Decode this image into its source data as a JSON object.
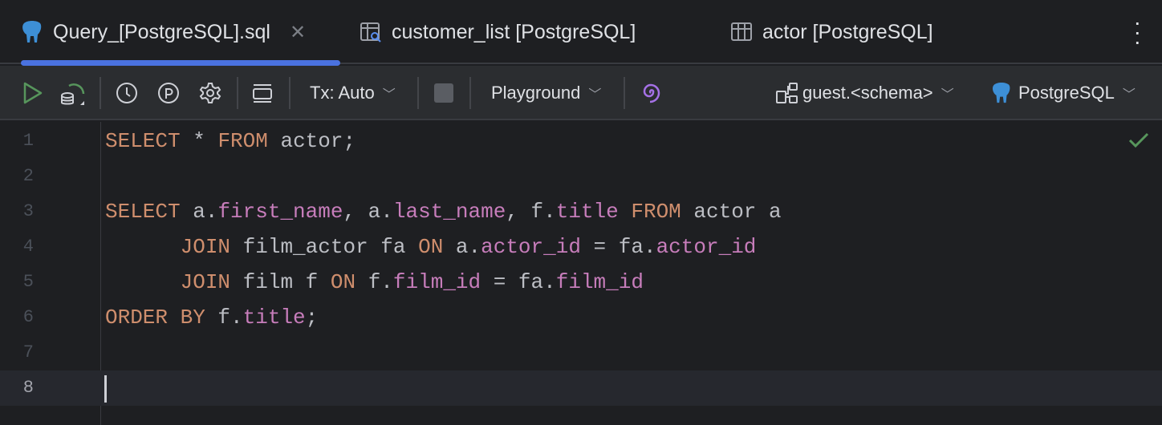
{
  "tabs": [
    {
      "label": "Query_[PostgreSQL].sql",
      "icon": "postgresql-icon",
      "active": true
    },
    {
      "label": "customer_list [PostgreSQL]",
      "icon": "table-view-icon"
    },
    {
      "label": "actor [PostgreSQL]",
      "icon": "table-icon"
    }
  ],
  "toolbar": {
    "tx": "Tx: Auto",
    "mode": "Playground",
    "schema": "guest.<schema>",
    "datasource": "PostgreSQL"
  },
  "editor": {
    "lines": [
      [
        [
          "kw",
          "SELECT"
        ],
        [
          "t",
          " * "
        ],
        [
          "kw",
          "FROM"
        ],
        [
          "t",
          " actor;"
        ]
      ],
      [],
      [
        [
          "kw",
          "SELECT"
        ],
        [
          "t",
          " a."
        ],
        [
          "col",
          "first_name"
        ],
        [
          "t",
          ", a."
        ],
        [
          "col",
          "last_name"
        ],
        [
          "t",
          ", f."
        ],
        [
          "col",
          "title"
        ],
        [
          "t",
          " "
        ],
        [
          "kw",
          "FROM"
        ],
        [
          "t",
          " actor a"
        ]
      ],
      [
        [
          "t",
          "      "
        ],
        [
          "kw",
          "JOIN"
        ],
        [
          "t",
          " film_actor fa "
        ],
        [
          "kw",
          "ON"
        ],
        [
          "t",
          " a."
        ],
        [
          "col",
          "actor_id"
        ],
        [
          "t",
          " = fa."
        ],
        [
          "col",
          "actor_id"
        ]
      ],
      [
        [
          "t",
          "      "
        ],
        [
          "kw",
          "JOIN"
        ],
        [
          "t",
          " film f "
        ],
        [
          "kw",
          "ON"
        ],
        [
          "t",
          " f."
        ],
        [
          "col",
          "film_id"
        ],
        [
          "t",
          " = fa."
        ],
        [
          "col",
          "film_id"
        ]
      ],
      [
        [
          "kw",
          "ORDER BY"
        ],
        [
          "t",
          " f."
        ],
        [
          "col",
          "title"
        ],
        [
          "t",
          ";"
        ]
      ],
      [],
      []
    ],
    "line_numbers": [
      "1",
      "2",
      "3",
      "4",
      "5",
      "6",
      "7",
      "8"
    ],
    "current_line": 8
  }
}
